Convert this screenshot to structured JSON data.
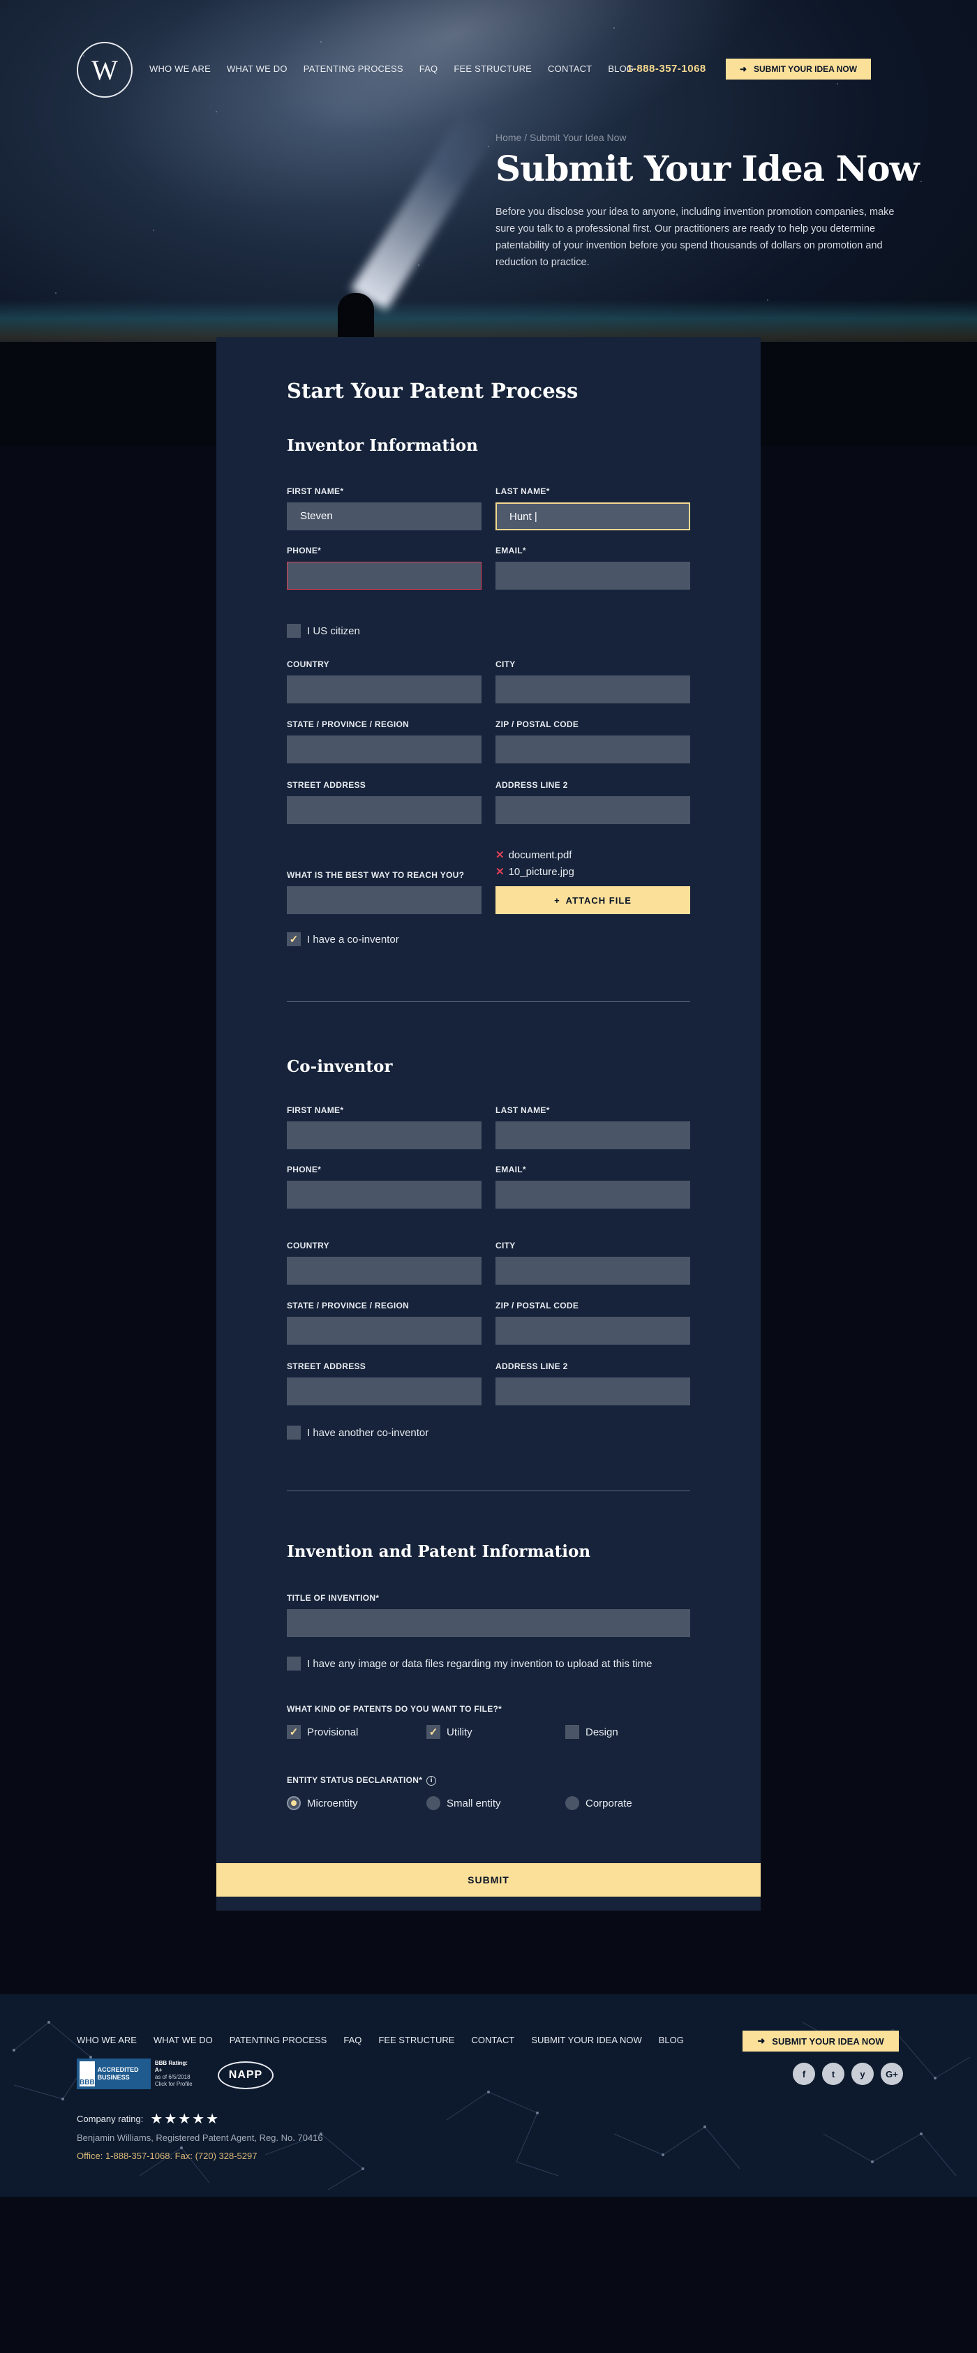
{
  "header": {
    "logo_letter": "W",
    "nav": [
      "WHO WE ARE",
      "WHAT WE DO",
      "PATENTING PROCESS",
      "FAQ",
      "FEE STRUCTURE",
      "CONTACT",
      "BLOG"
    ],
    "phone": "1-888-357-1068",
    "cta_label": "SUBMIT YOUR IDEA NOW"
  },
  "hero": {
    "breadcrumb": "Home / Submit Your Idea Now",
    "title": "Submit Your Idea Now",
    "text": "Before you disclose your idea to anyone, including invention promotion companies, make sure you talk to a professional first. Our practitioners are ready to help you determine patentability of your invention before you spend thousands of dollars on promotion and reduction to practice."
  },
  "form": {
    "title": "Start Your Patent Process",
    "inventor": {
      "heading": "Inventor Information",
      "first_name_label": "FIRST NAME*",
      "first_name_value": "Steven",
      "last_name_label": "LAST NAME*",
      "last_name_value": "Hunt |",
      "phone_label": "PHONE*",
      "email_label": "EMAIL*",
      "us_citizen_label": "I US citizen",
      "country_label": "COUNTRY",
      "city_label": "CITY",
      "state_label": "STATE / PROVINCE / REGION",
      "zip_label": "ZIP / POSTAL CODE",
      "street_label": "STREET ADDRESS",
      "address2_label": "ADDRESS LINE 2",
      "reach_label": "WHAT IS THE BEST WAY TO REACH YOU?",
      "files": [
        "document.pdf",
        "10_picture.jpg"
      ],
      "attach_label": "ATTACH FILE",
      "coinventor_label": "I have a co-inventor",
      "coinventor_checked": true
    },
    "coinventor": {
      "heading": "Co-inventor",
      "first_name_label": "FIRST NAME*",
      "last_name_label": "LAST NAME*",
      "phone_label": "PHONE*",
      "email_label": "EMAIL*",
      "country_label": "COUNTRY",
      "city_label": "CITY",
      "state_label": "STATE / PROVINCE / REGION",
      "zip_label": "ZIP / POSTAL CODE",
      "street_label": "STREET ADDRESS",
      "address2_label": "ADDRESS LINE 2",
      "another_label": "I have another co-inventor"
    },
    "invention": {
      "heading": "Invention and Patent Information",
      "title_label": "TITLE OF INVENTION*",
      "files_label": "I have any image or data files regarding my invention to upload at this time",
      "patents_label": "WHAT KIND OF PATENTS DO YOU WANT TO FILE?*",
      "patent_types": [
        {
          "label": "Provisional",
          "checked": true
        },
        {
          "label": "Utility",
          "checked": true
        },
        {
          "label": "Design",
          "checked": false
        }
      ],
      "entity_label": "ENTITY STATUS DECLARATION*",
      "entity_options": [
        {
          "label": "Microentity",
          "selected": true
        },
        {
          "label": "Small entity",
          "selected": false
        },
        {
          "label": "Corporate",
          "selected": false
        }
      ]
    },
    "submit_label": "SUBMIT"
  },
  "footer": {
    "nav": [
      "WHO WE ARE",
      "WHAT WE DO",
      "PATENTING PROCESS",
      "FAQ",
      "FEE STRUCTURE",
      "CONTACT",
      "SUBMIT YOUR IDEA NOW",
      "BLOG"
    ],
    "cta_label": "SUBMIT YOUR IDEA NOW",
    "bbb_seal": "BBB",
    "bbb_accredited": "ACCREDITED BUSINESS",
    "bbb_rating": "BBB Rating: A+",
    "bbb_asof": "as of 6/5/2018",
    "bbb_click": "Click for Profile",
    "napp": "NAPP",
    "social": [
      "f",
      "t",
      "y",
      "G+"
    ],
    "rating_label": "Company rating:",
    "rating_stars": "★★★★★",
    "agent": "Benjamin Williams, Registered Patent Agent, Reg. No. 70416",
    "office": "Office: 1-888-357-1068. Fax: (720) 328-5297"
  },
  "colors": {
    "accent": "#fbe09a",
    "card": "#16233a",
    "field": "#4a5568",
    "error": "#e04057"
  }
}
